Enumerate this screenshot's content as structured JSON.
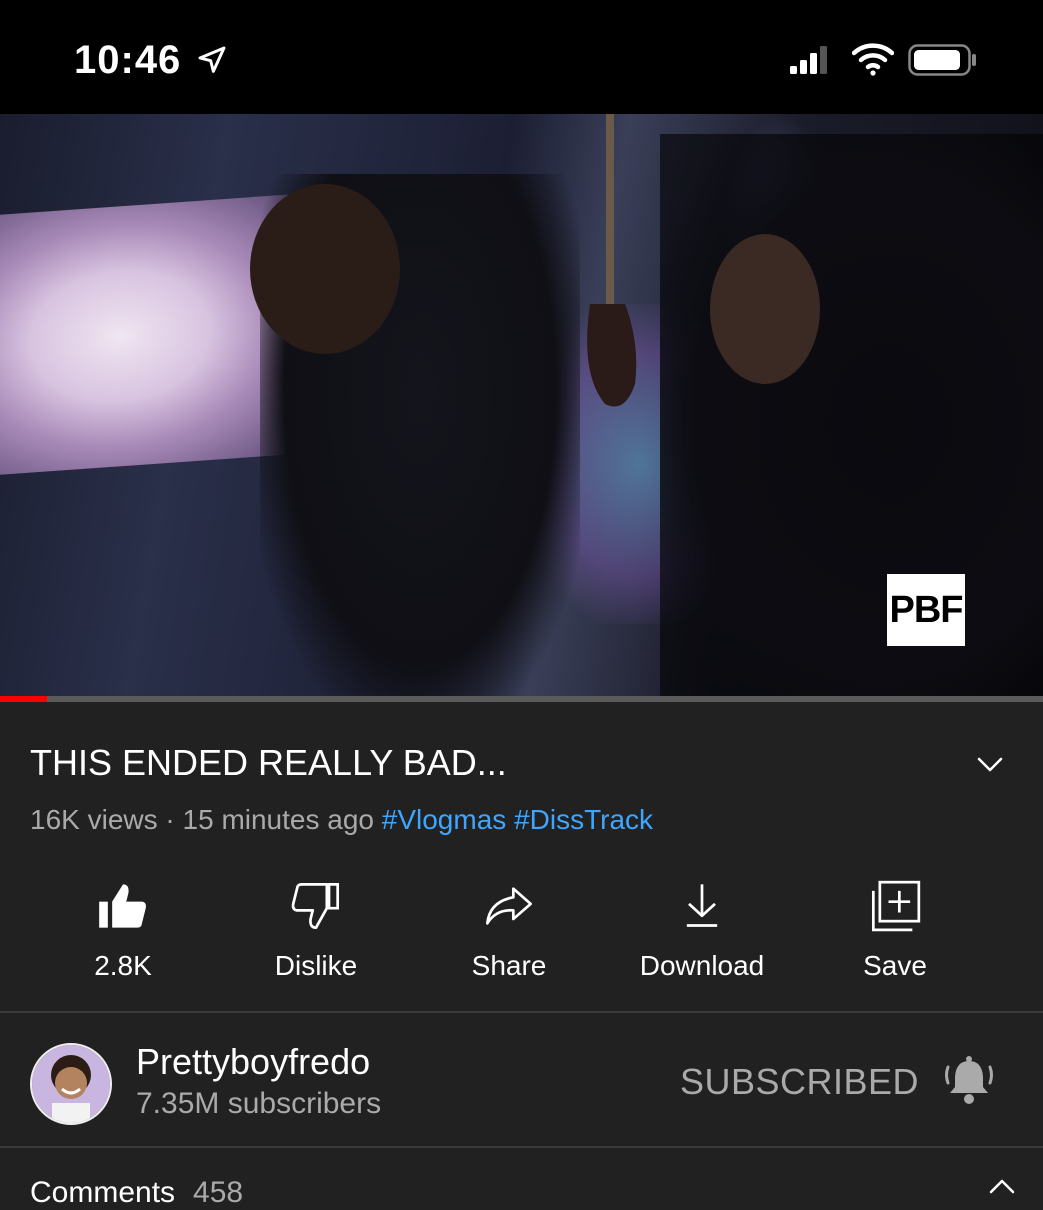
{
  "status_bar": {
    "time": "10:46",
    "icons": [
      "location-arrow-icon",
      "cellular-signal-icon",
      "wifi-icon",
      "battery-icon"
    ]
  },
  "video": {
    "watermark": "PBF",
    "progress_fraction": 0.045,
    "progress_color": "#ff0000"
  },
  "details": {
    "title": "THIS ENDED REALLY BAD...",
    "views": "16K views",
    "separator": "·",
    "age": "15 minutes ago",
    "hashtags": [
      "#Vlogmas",
      "#DissTrack"
    ]
  },
  "actions": [
    {
      "label": "2.8K",
      "icon": "thumbs-up-icon"
    },
    {
      "label": "Dislike",
      "icon": "thumbs-down-icon"
    },
    {
      "label": "Share",
      "icon": "share-icon"
    },
    {
      "label": "Download",
      "icon": "download-icon"
    },
    {
      "label": "Save",
      "icon": "save-to-playlist-icon"
    }
  ],
  "channel": {
    "name": "Prettyboyfredo",
    "subscribers": "7.35M subscribers",
    "subscribe_state": "SUBSCRIBED",
    "bell_icon": "notification-bell-icon"
  },
  "comments": {
    "label": "Comments",
    "count": "458"
  },
  "colors": {
    "background": "#212121",
    "link": "#3ea6ff",
    "secondary_text": "#aaaaaa"
  }
}
